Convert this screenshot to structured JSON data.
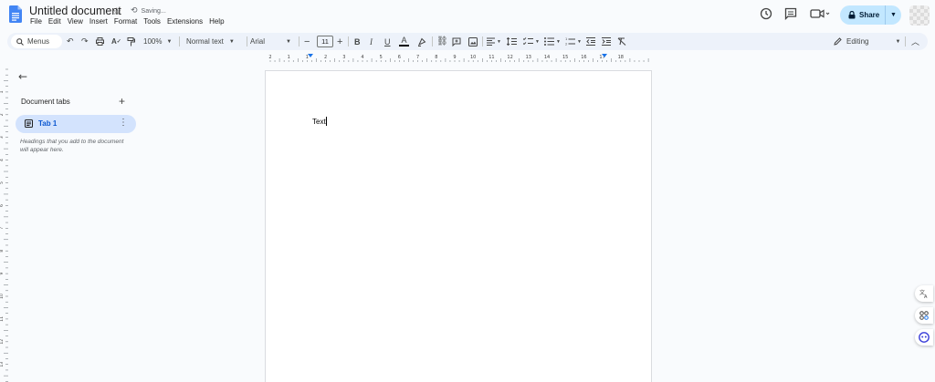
{
  "header": {
    "title": "Untitled document",
    "save_status": "Saving...",
    "menu": [
      "File",
      "Edit",
      "View",
      "Insert",
      "Format",
      "Tools",
      "Extensions",
      "Help"
    ],
    "share_label": "Share",
    "colors": {
      "share_bg": "#c2e7ff",
      "accent": "#0b57d0"
    }
  },
  "toolbar": {
    "menus_label": "Menus",
    "zoom": "100%",
    "style": "Normal text",
    "font": "Arial",
    "font_size": "11",
    "mode": "Editing"
  },
  "ruler": {
    "top_labels": [
      "2",
      "1",
      "1",
      "2",
      "3",
      "4",
      "5",
      "6",
      "7",
      "8",
      "9",
      "10",
      "11",
      "12",
      "13",
      "14",
      "15",
      "16",
      "17",
      "18"
    ],
    "left_labels": [
      "1",
      "2",
      "3",
      "4",
      "5",
      "6",
      "7",
      "8",
      "9",
      "10",
      "11",
      "12",
      "13",
      "14"
    ]
  },
  "sidebar": {
    "title": "Document tabs",
    "tabs": [
      {
        "label": "Tab 1"
      }
    ],
    "hint": "Headings that you add to the document will appear here."
  },
  "document": {
    "body_text": "Text"
  }
}
